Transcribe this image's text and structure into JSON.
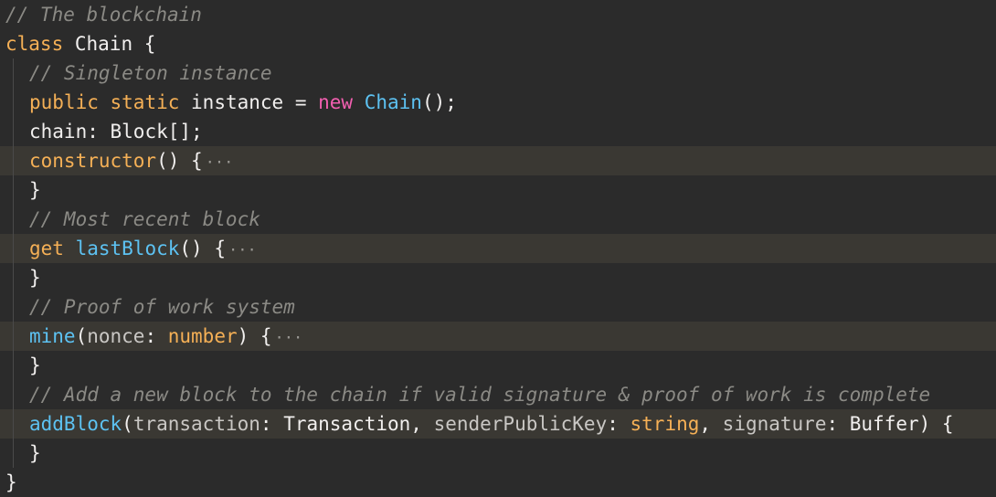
{
  "code": {
    "l01": {
      "comment": "// The blockchain"
    },
    "l02": {
      "kw": "class",
      "name": "Chain",
      "brace": " {"
    },
    "l03": {
      "comment": "// Singleton instance"
    },
    "l04": {
      "kw1": "public",
      "kw2": "static",
      "prop": "instance",
      "eq": " = ",
      "new": "new",
      "cls": "Chain",
      "tail": "();"
    },
    "l05": {
      "prop": "chain",
      "colon": ": ",
      "type": "Block",
      "tail": "[];"
    },
    "l06": {
      "fn": "constructor",
      "tail": "() {",
      "dots": "···"
    },
    "l07": {
      "brace": "}"
    },
    "l08": {
      "comment": "// Most recent block"
    },
    "l09": {
      "kw": "get",
      "fn": "lastBlock",
      "tail": "() {",
      "dots": "···"
    },
    "l10": {
      "brace": "}"
    },
    "l11": {
      "comment": "// Proof of work system"
    },
    "l12": {
      "fn": "mine",
      "open": "(",
      "param": "nonce",
      "colon": ": ",
      "type": "number",
      "tail": ") {",
      "dots": "···"
    },
    "l13": {
      "brace": "}"
    },
    "l14": {
      "comment": "// Add a new block to the chain if valid signature & proof of work is complete"
    },
    "l15": {
      "fn": "addBlock",
      "open": "(",
      "p1": "transaction",
      "c1": ": ",
      "t1": "Transaction",
      "sep1": ", ",
      "p2": "senderPublicKey",
      "c2": ": ",
      "t2": "string",
      "sep2": ", ",
      "p3": "signature",
      "c3": ": ",
      "t3": "Buffer",
      "tail": ") {"
    },
    "l16": {
      "brace": "}"
    },
    "l17": {
      "brace": "}"
    }
  },
  "colors": {
    "background": "#2b2b2b",
    "comment": "#8b8a85",
    "keyword": "#f5b056",
    "new_keyword": "#f25fb0",
    "function": "#5dc2f2",
    "folded_line_highlight": "#3a3833"
  }
}
